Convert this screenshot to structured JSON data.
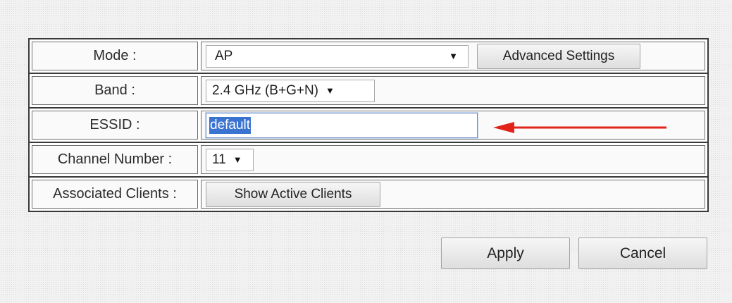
{
  "form": {
    "mode": {
      "label": "Mode :",
      "selected": "AP",
      "advanced_button": "Advanced Settings"
    },
    "band": {
      "label": "Band :",
      "selected": "2.4 GHz (B+G+N)"
    },
    "essid": {
      "label": "ESSID :",
      "value": "default"
    },
    "channel": {
      "label": "Channel Number :",
      "selected": "11"
    },
    "clients": {
      "label": "Associated Clients :",
      "button": "Show Active Clients"
    }
  },
  "actions": {
    "apply": "Apply",
    "cancel": "Cancel"
  },
  "icons": {
    "dropdown": "chevron-down-icon",
    "annotation": "red-arrow-left-icon"
  },
  "colors": {
    "annotation_arrow": "#e2231a",
    "selection_highlight": "#3b73d1",
    "table_border": "#3a3a3a"
  },
  "glyphs": {
    "dropdown_arrow": "▼"
  }
}
